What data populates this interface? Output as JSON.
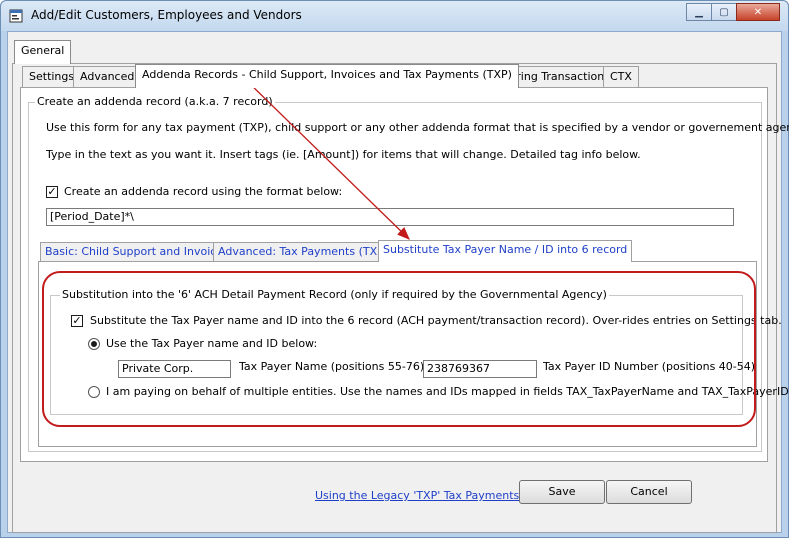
{
  "window": {
    "title": "Add/Edit Customers, Employees and Vendors",
    "controls": {
      "minimize": "▁",
      "maximize": "▢",
      "close": "✕"
    }
  },
  "top_tab": {
    "label": "General"
  },
  "tabs": [
    {
      "label": "Settings"
    },
    {
      "label": "Advanced"
    },
    {
      "label": "Addenda Records - Child Support, Invoices and Tax Payments (TXP)"
    },
    {
      "label": "Recurring Transactions"
    },
    {
      "label": "CTX"
    }
  ],
  "addenda": {
    "group_title": "Create an addenda record (a.k.a. 7 record)",
    "intro_line1": "Use this form for any tax payment (TXP), child support or any other addenda format that is specified by a vendor or governement agency.",
    "intro_line2": "Type in the text as you want it.  Insert tags (ie. [Amount]) for items that will change. Detailed tag info below.",
    "create_check_label": "Create an addenda record using the format below:",
    "format_value": "[Period_Date]*\\"
  },
  "sub_tabs": [
    {
      "label": "Basic: Child Support and Invoices"
    },
    {
      "label": "Advanced: Tax Payments (TXP)"
    },
    {
      "label": "Substitute Tax Payer Name / ID into 6 record"
    }
  ],
  "substitution": {
    "group_title": "Substitution into the '6' ACH Detail Payment Record (only if required by the Governmental Agency)",
    "substitute_check_label": "Substitute the Tax Payer name and ID into the 6 record (ACH payment/transaction record). Over-rides entries on Settings tab.",
    "radio_use_label": "Use the Tax Payer name and ID below:",
    "payer_name_value": "Private Corp.",
    "payer_name_label": "Tax Payer Name (positions 55-76)",
    "payer_id_value": "238769367",
    "payer_id_label": "Tax Payer ID Number (positions 40-54)",
    "radio_multiple_label": "I am paying on behalf of multiple entities.  Use the names and IDs mapped in fields TAX_TaxPayerName and TAX_TaxPayerID."
  },
  "footer": {
    "legacy_link": "Using the Legacy 'TXP' Tax Payments?",
    "save_label": "Save",
    "cancel_label": "Cancel"
  },
  "colors": {
    "annotation": "#c21b1b",
    "link": "#1f3fc8"
  },
  "icons": {
    "app": "app-icon",
    "check": "✓"
  }
}
